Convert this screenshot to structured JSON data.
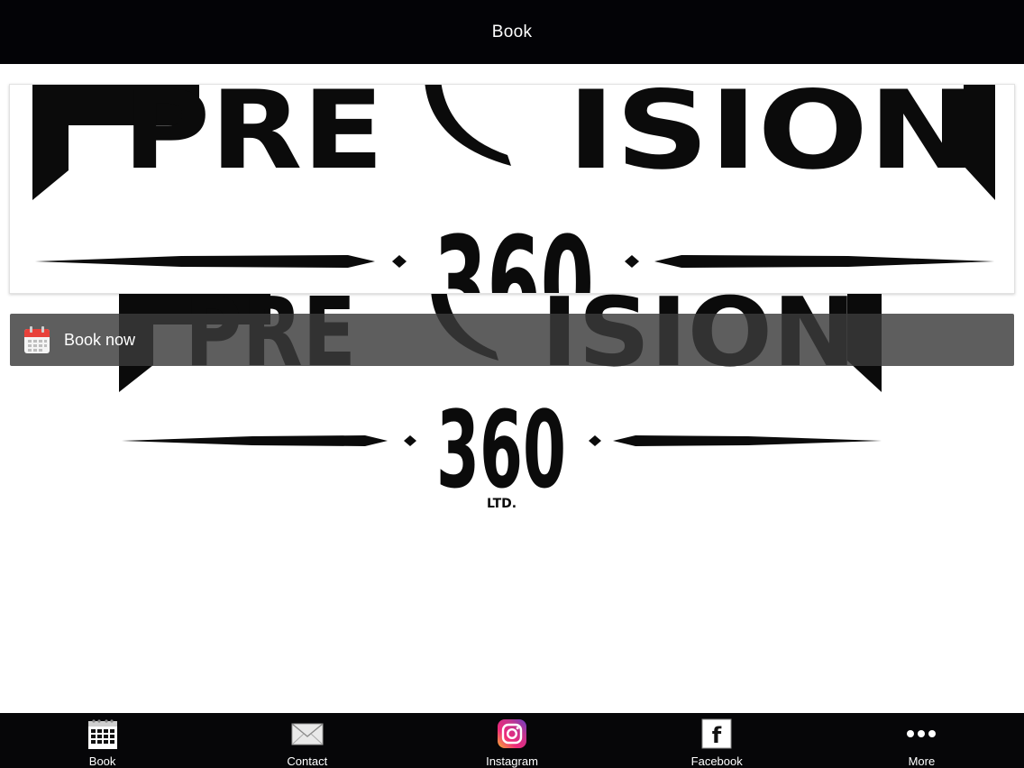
{
  "navbar": {
    "title": "Book"
  },
  "logo": {
    "word_left": "PRE",
    "word_right": "ISION",
    "number": "360",
    "suffix": "LTD."
  },
  "book_now": {
    "label": "Book now",
    "icon": "calendar-icon"
  },
  "tabbar": {
    "tabs": [
      {
        "label": "Book",
        "icon": "calendar-grid-icon"
      },
      {
        "label": "Contact",
        "icon": "envelope-icon"
      },
      {
        "label": "Instagram",
        "icon": "instagram-icon"
      },
      {
        "label": "Facebook",
        "icon": "facebook-icon"
      },
      {
        "label": "More",
        "icon": "more-dots-icon"
      }
    ]
  },
  "colors": {
    "navbar": "#030306",
    "tabbar": "#060608",
    "book_bar": "#3a3a3a",
    "calendar_red": "#e8413a"
  }
}
